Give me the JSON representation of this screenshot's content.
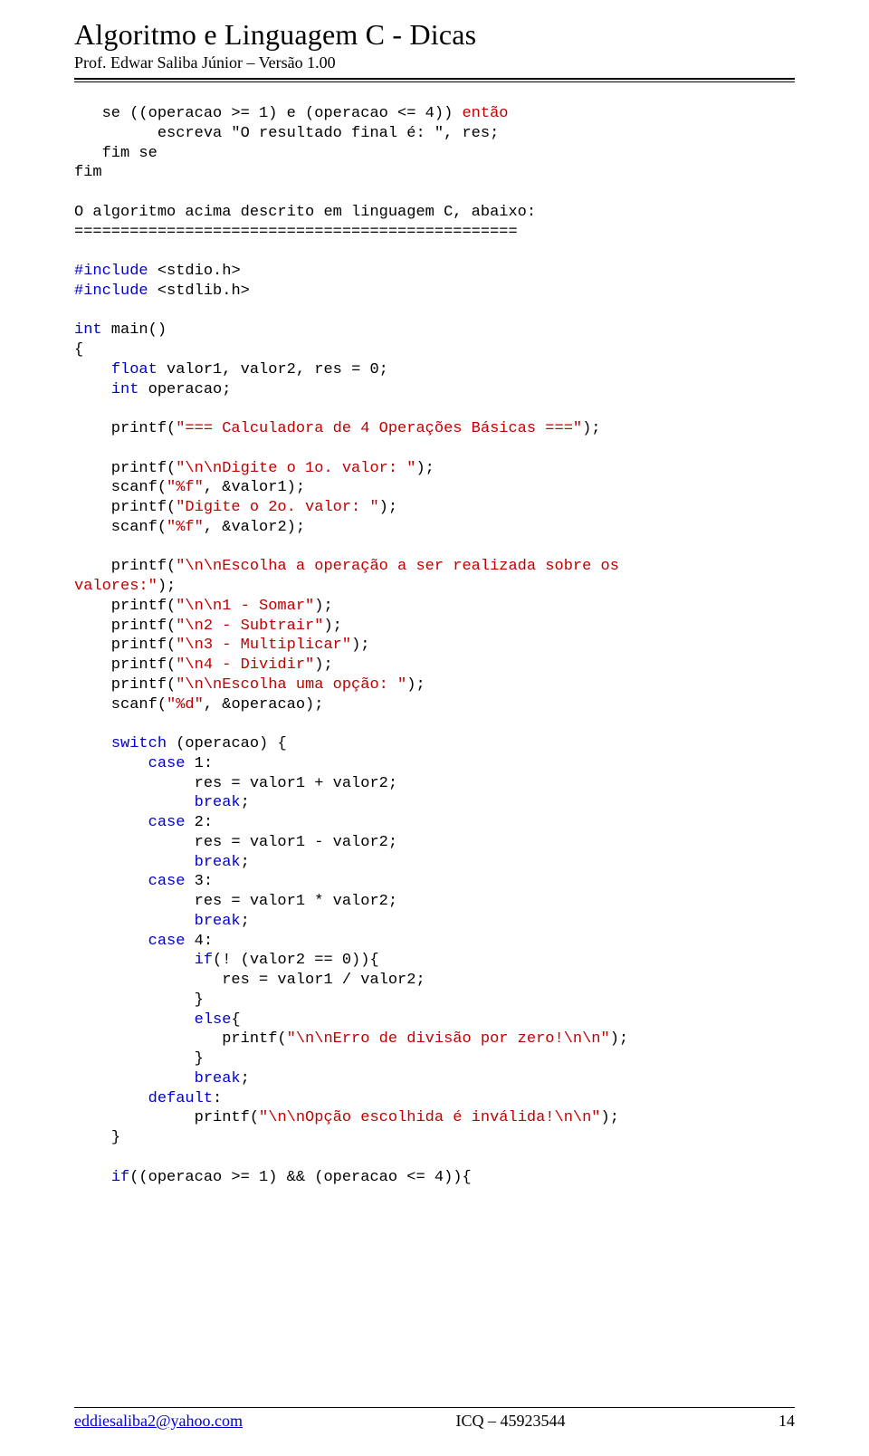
{
  "header": {
    "title": "Algoritmo e Linguagem C - Dicas",
    "subtitle": "Prof. Edwar Saliba Júnior – Versão 1.00"
  },
  "pseudo": {
    "l1a": "   se ((operacao >= 1) e (operacao <= 4)) ",
    "l1b": "então",
    "l2": "         escreva \"O resultado final é: \", res;",
    "l3": "   fim se",
    "l4": "fim"
  },
  "transition": {
    "l1": "O algoritmo acima descrito em linguagem C, abaixo:",
    "l2": "================================================"
  },
  "code": {
    "inc1a": "#include ",
    "inc1b": "<stdio.h>",
    "inc2a": "#include ",
    "inc2b": "<stdlib.h>",
    "kw_int": "int",
    "main_tail": " main()",
    "brace_open": "{",
    "decl_float": "float",
    "decl_float_tail": " valor1, valor2, res = 0;",
    "decl_int": "int",
    "decl_int_tail": " operacao;",
    "p_calc_a": "    printf(",
    "p_calc_str": "\"=== Calculadora de 4 Operações Básicas ===\"",
    "p_calc_c": ");",
    "p_d1_a": "    printf(",
    "p_d1_s": "\"\\n\\nDigite o 1o. valor: \"",
    "p_d1_c": ");",
    "s_d1_a": "    scanf(",
    "s_d1_s": "\"%f\"",
    "s_d1_c": ", &valor1);",
    "p_d2_a": "    printf(",
    "p_d2_s": "\"Digite o 2o. valor: \"",
    "p_d2_c": ");",
    "s_d2_a": "    scanf(",
    "s_d2_s": "\"%f\"",
    "s_d2_c": ", &valor2);",
    "p_esc_a": "    printf(",
    "p_esc_s": "\"\\n\\nEscolha a operação a ser realizada sobre os",
    "p_esc_s2": "valores:\"",
    "p_esc_c": ");",
    "p_m1_a": "    printf(",
    "p_m1_s": "\"\\n\\n1 - Somar\"",
    "p_m1_c": ");",
    "p_m2_a": "    printf(",
    "p_m2_s": "\"\\n2 - Subtrair\"",
    "p_m2_c": ");",
    "p_m3_a": "    printf(",
    "p_m3_s": "\"\\n3 - Multiplicar\"",
    "p_m3_c": ");",
    "p_m4_a": "    printf(",
    "p_m4_s": "\"\\n4 - Dividir\"",
    "p_m4_c": ");",
    "p_op_a": "    printf(",
    "p_op_s": "\"\\n\\nEscolha uma opção: \"",
    "p_op_c": ");",
    "s_op_a": "    scanf(",
    "s_op_s": "\"%d\"",
    "s_op_c": ", &operacao);",
    "sw_kw": "switch",
    "sw_tail": " (operacao) {",
    "case_kw": "case",
    "c1_lbl": " 1:",
    "c1_body": "             res = valor1 + valor2;",
    "c2_lbl": " 2:",
    "c2_body": "             res = valor1 - valor2;",
    "c3_lbl": " 3:",
    "c3_body": "             res = valor1 * valor2;",
    "c4_lbl": " 4:",
    "break_kw": "break",
    "semi": ";",
    "if_kw": "if",
    "if_tail": "(! (valor2 == 0)){",
    "if_body": "                res = valor1 / valor2;",
    "cb": "}",
    "else_kw": "else",
    "else_tail": "{",
    "p_err_a": "                printf(",
    "p_err_s": "\"\\n\\nErro de divisão por zero!\\n\\n\"",
    "p_err_c": ");",
    "default_kw": "default",
    "colon": ":",
    "p_inv_a": "             printf(",
    "p_inv_s": "\"\\n\\nOpção escolhida é inválida!\\n\\n\"",
    "p_inv_c": ");",
    "if2_kw": "if",
    "if2_tail": "((operacao >= 1) && (operacao <= 4)){"
  },
  "footer": {
    "email": "eddiesaliba2@yahoo.com",
    "icq": "ICQ – 45923544",
    "page": "14"
  }
}
